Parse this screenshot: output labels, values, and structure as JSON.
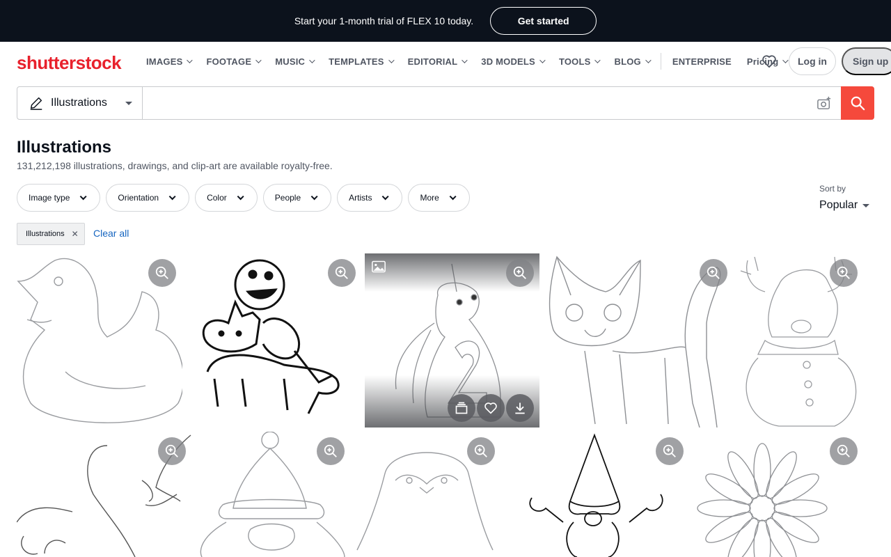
{
  "promo": {
    "text": "Start your 1-month trial of FLEX 10 today.",
    "cta": "Get started"
  },
  "brand": {
    "logo": "shutterstock",
    "accent": "#e8212c"
  },
  "nav": {
    "items": [
      "IMAGES",
      "FOOTAGE",
      "MUSIC",
      "TEMPLATES",
      "EDITORIAL",
      "3D MODELS",
      "TOOLS",
      "BLOG"
    ],
    "enterprise": "ENTERPRISE",
    "pricing": "Pricing",
    "login": "Log in",
    "signup": "Sign up"
  },
  "search": {
    "type": "Illustrations",
    "value": "",
    "button_color": "#f5493c"
  },
  "page": {
    "title": "Illustrations",
    "subtitle": "131,212,198 illustrations, drawings, and clip-art are available royalty-free."
  },
  "filters": [
    "Image type",
    "Orientation",
    "Color",
    "People",
    "Artists",
    "More"
  ],
  "sort": {
    "label": "Sort by",
    "value": "Popular"
  },
  "active_filters": {
    "chip": "Illustrations",
    "clear": "Clear all"
  },
  "results": [
    {
      "icon": "duck-outline-illustration"
    },
    {
      "icon": "monster-riding-cat-illustration"
    },
    {
      "icon": "unicorn-number-two-illustration",
      "hovered": true
    },
    {
      "icon": "kitten-outline-illustration"
    },
    {
      "icon": "reindeer-snowman-illustration"
    },
    {
      "icon": "face-line-art-illustration"
    },
    {
      "icon": "santa-claus-outline-illustration"
    },
    {
      "icon": "penguin-outline-illustration"
    },
    {
      "icon": "gnome-outline-illustration"
    },
    {
      "icon": "daisy-flower-outline-illustration"
    }
  ]
}
